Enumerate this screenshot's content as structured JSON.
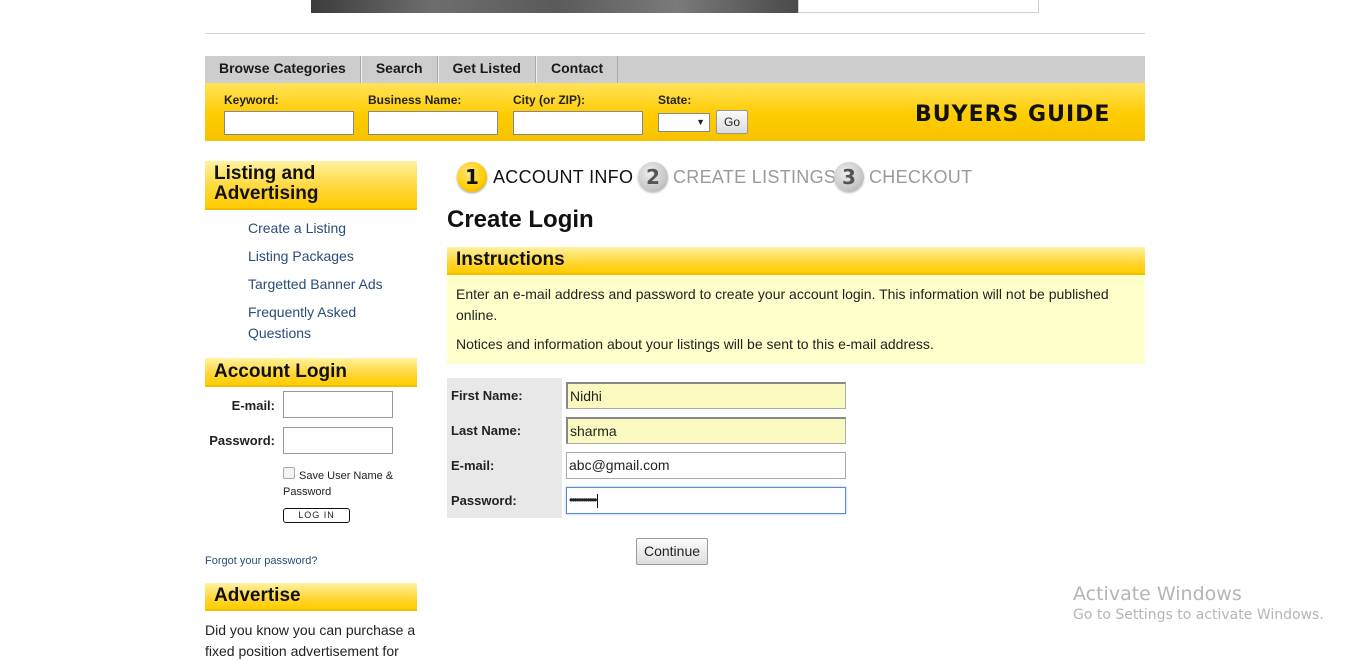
{
  "nav": {
    "items": [
      {
        "label": "Browse Categories"
      },
      {
        "label": "Search"
      },
      {
        "label": "Get Listed"
      },
      {
        "label": "Contact"
      }
    ]
  },
  "search": {
    "keyword_label": "Keyword:",
    "business_label": "Business Name:",
    "city_label": "City (or ZIP):",
    "state_label": "State:",
    "state_value": "",
    "go_label": "Go",
    "brand": "BUYERS GUIDE"
  },
  "sidebar": {
    "listing_heading": "Listing and Advertising",
    "links": [
      {
        "label": "Create a Listing"
      },
      {
        "label": "Listing Packages"
      },
      {
        "label": "Targetted Banner Ads"
      },
      {
        "label": "Frequently Asked Questions"
      }
    ],
    "login_heading": "Account Login",
    "email_label": "E-mail:",
    "password_label": "Password:",
    "save_label": "Save User Name & Password",
    "login_button": "LOG IN",
    "forgot": "Forgot your password?",
    "advertise_heading": "Advertise",
    "advertise_text": "Did you know you can purchase a fixed position advertisement for"
  },
  "steps": [
    {
      "number": "1",
      "label": "ACCOUNT INFO",
      "active": true
    },
    {
      "number": "2",
      "label": "CREATE LISTINGS",
      "active": false
    },
    {
      "number": "3",
      "label": "CHECKOUT",
      "active": false
    }
  ],
  "main": {
    "title": "Create Login",
    "instructions_heading": "Instructions",
    "instructions_p1": "Enter an e-mail address and password to create your account login. This information will not be published online.",
    "instructions_p2": "Notices and information about your listings will be sent to this e-mail address."
  },
  "form": {
    "first_name_label": "First Name:",
    "first_name_value": "Nidhi",
    "last_name_label": "Last Name:",
    "last_name_value": "sharma",
    "email_label": "E-mail:",
    "email_value": "abc@gmail.com",
    "password_label": "Password:",
    "password_mask": "••••••••••••",
    "continue_label": "Continue"
  },
  "watermark": {
    "title": "Activate Windows",
    "subtitle": "Go to Settings to activate Windows."
  },
  "colors": {
    "accent_yellow": "#ffcc00",
    "instructions_bg": "#ffffcc",
    "link_blue": "#2a4d7a"
  }
}
